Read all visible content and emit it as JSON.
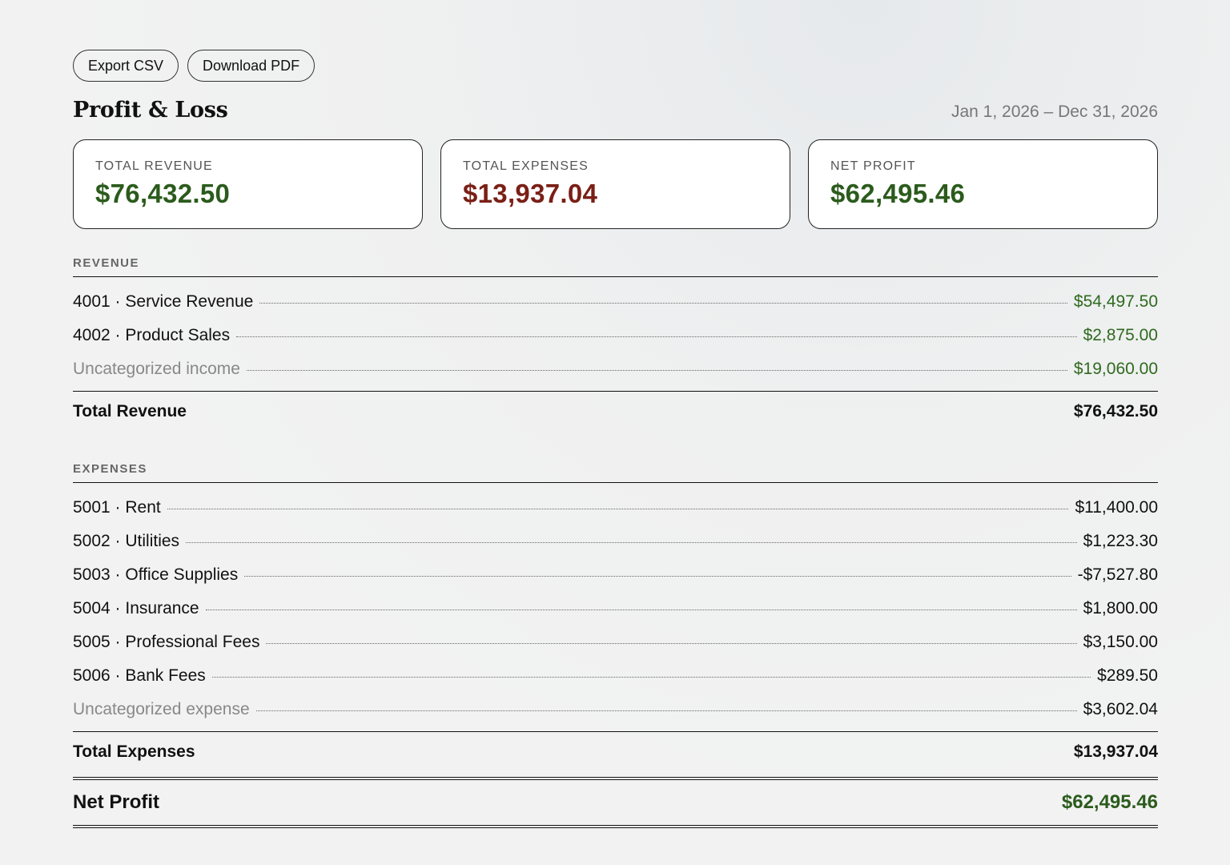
{
  "actions": {
    "export_csv": "Export CSV",
    "download_pdf": "Download PDF"
  },
  "header": {
    "title": "Profit & Loss",
    "date_range": "Jan 1, 2026 – Dec 31, 2026"
  },
  "summary": {
    "revenue": {
      "label": "TOTAL REVENUE",
      "value": "$76,432.50"
    },
    "expenses": {
      "label": "TOTAL EXPENSES",
      "value": "$13,937.04"
    },
    "net": {
      "label": "NET PROFIT",
      "value": "$62,495.46"
    }
  },
  "revenue": {
    "label": "REVENUE",
    "rows": [
      {
        "name": "4001 · Service Revenue",
        "amount": "$54,497.50"
      },
      {
        "name": "4002 · Product Sales",
        "amount": "$2,875.00"
      },
      {
        "name": "Uncategorized income",
        "amount": "$19,060.00"
      }
    ],
    "total_label": "Total Revenue",
    "total_value": "$76,432.50"
  },
  "expenses": {
    "label": "EXPENSES",
    "rows": [
      {
        "name": "5001 · Rent",
        "amount": "$11,400.00"
      },
      {
        "name": "5002 · Utilities",
        "amount": "$1,223.30"
      },
      {
        "name": "5003 · Office Supplies",
        "amount": "-$7,527.80"
      },
      {
        "name": "5004 · Insurance",
        "amount": "$1,800.00"
      },
      {
        "name": "5005 · Professional Fees",
        "amount": "$3,150.00"
      },
      {
        "name": "5006 · Bank Fees",
        "amount": "$289.50"
      },
      {
        "name": "Uncategorized expense",
        "amount": "$3,602.04"
      }
    ],
    "total_label": "Total Expenses",
    "total_value": "$13,937.04"
  },
  "net_profit": {
    "label": "Net Profit",
    "value": "$62,495.46"
  },
  "colors": {
    "positive": "#2b5b1c",
    "negative": "#7a1f16",
    "muted": "#888888"
  }
}
